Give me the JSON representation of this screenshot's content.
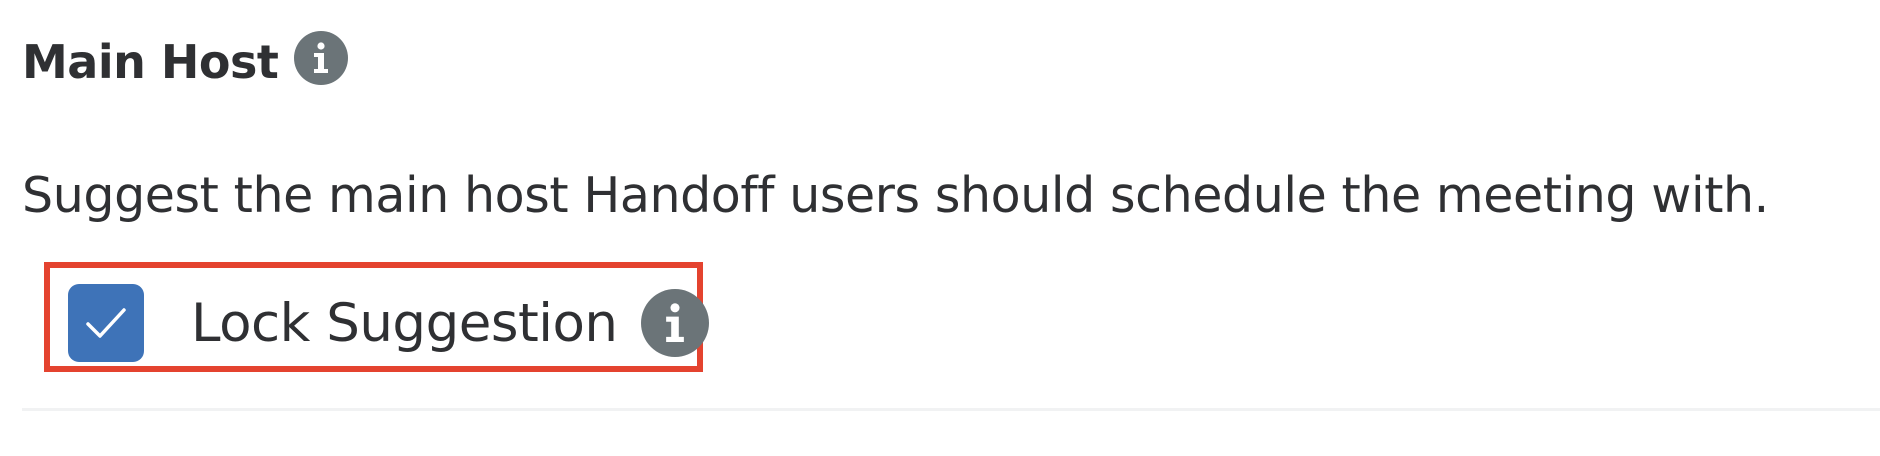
{
  "section": {
    "title": "Main Host",
    "title_info_icon": "info-icon"
  },
  "description": "Suggest the main host Handoff users should schedule the meeting with.",
  "lock_suggestion": {
    "label": "Lock Suggestion",
    "checked": true,
    "info_icon": "info-icon"
  },
  "colors": {
    "text": "#2f3033",
    "icon_bg": "#6b7478",
    "checkbox_bg": "#3e73b8",
    "highlight_border": "#e4432f"
  }
}
